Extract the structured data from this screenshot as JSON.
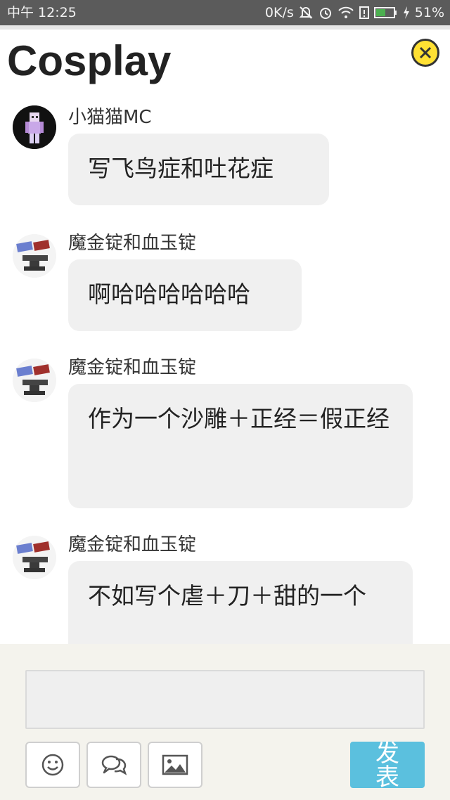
{
  "status_bar": {
    "time": "中午 12:25",
    "net_speed": "0K/s",
    "battery": "51%"
  },
  "header": {
    "title": "Cosplay"
  },
  "messages": [
    {
      "sender": "小猫猫MC",
      "text": "写飞鸟症和吐花症",
      "avatar": "minecraft-skin-avatar"
    },
    {
      "sender": "魔金锭和血玉锭",
      "text": "啊哈哈哈哈哈哈",
      "avatar": "ingots-anvil-avatar"
    },
    {
      "sender": "魔金锭和血玉锭",
      "text": "作为一个沙雕＋正经＝假正经",
      "avatar": "ingots-anvil-avatar"
    },
    {
      "sender": "魔金锭和血玉锭",
      "text": "不如写个虐＋刀＋甜的一个",
      "avatar": "ingots-anvil-avatar"
    }
  ],
  "composer": {
    "input_value": "",
    "send_label": "发表",
    "tools": [
      "emoji-icon",
      "chat-bubbles-icon",
      "image-icon"
    ]
  },
  "colors": {
    "accent": "#5bc0de",
    "close": "#ffe033",
    "bubble": "#f0f0f0",
    "composer_bg": "#f4f3ed"
  }
}
